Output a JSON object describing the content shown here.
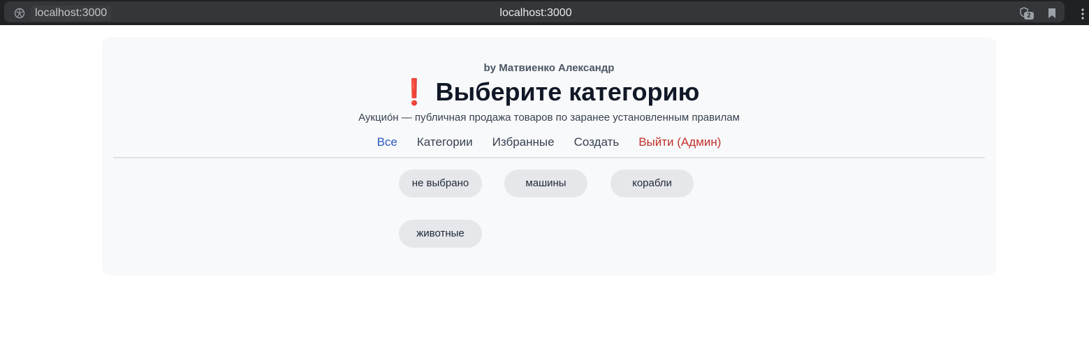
{
  "browser": {
    "url_chip": "localhost:3000",
    "address": "localhost:3000",
    "extension_badge": "2"
  },
  "header": {
    "author": "by Матвиенко Александр",
    "title_icon": "❗",
    "title": "Выберите категорию",
    "subtitle": "Аукцио́н — публичная продажа товаров по заранее установленным правилам"
  },
  "nav": {
    "items": [
      {
        "label": "Все",
        "active": true
      },
      {
        "label": "Категории"
      },
      {
        "label": "Избранные"
      },
      {
        "label": "Создать"
      },
      {
        "label": "Выйти (Админ)"
      }
    ]
  },
  "categories": {
    "items": [
      {
        "label": "не выбрано"
      },
      {
        "label": "машины"
      },
      {
        "label": "корабли"
      },
      {
        "label": "животные"
      }
    ]
  },
  "colors": {
    "nav_active": "#2b59c3",
    "nav_logout": "#c2302a",
    "title_icon": "#e11d2e"
  },
  "icons": {
    "site": "globe-icon",
    "extension": "shield-icon",
    "bookmark": "bookmark-icon",
    "menu": "kebab-menu-icon"
  }
}
